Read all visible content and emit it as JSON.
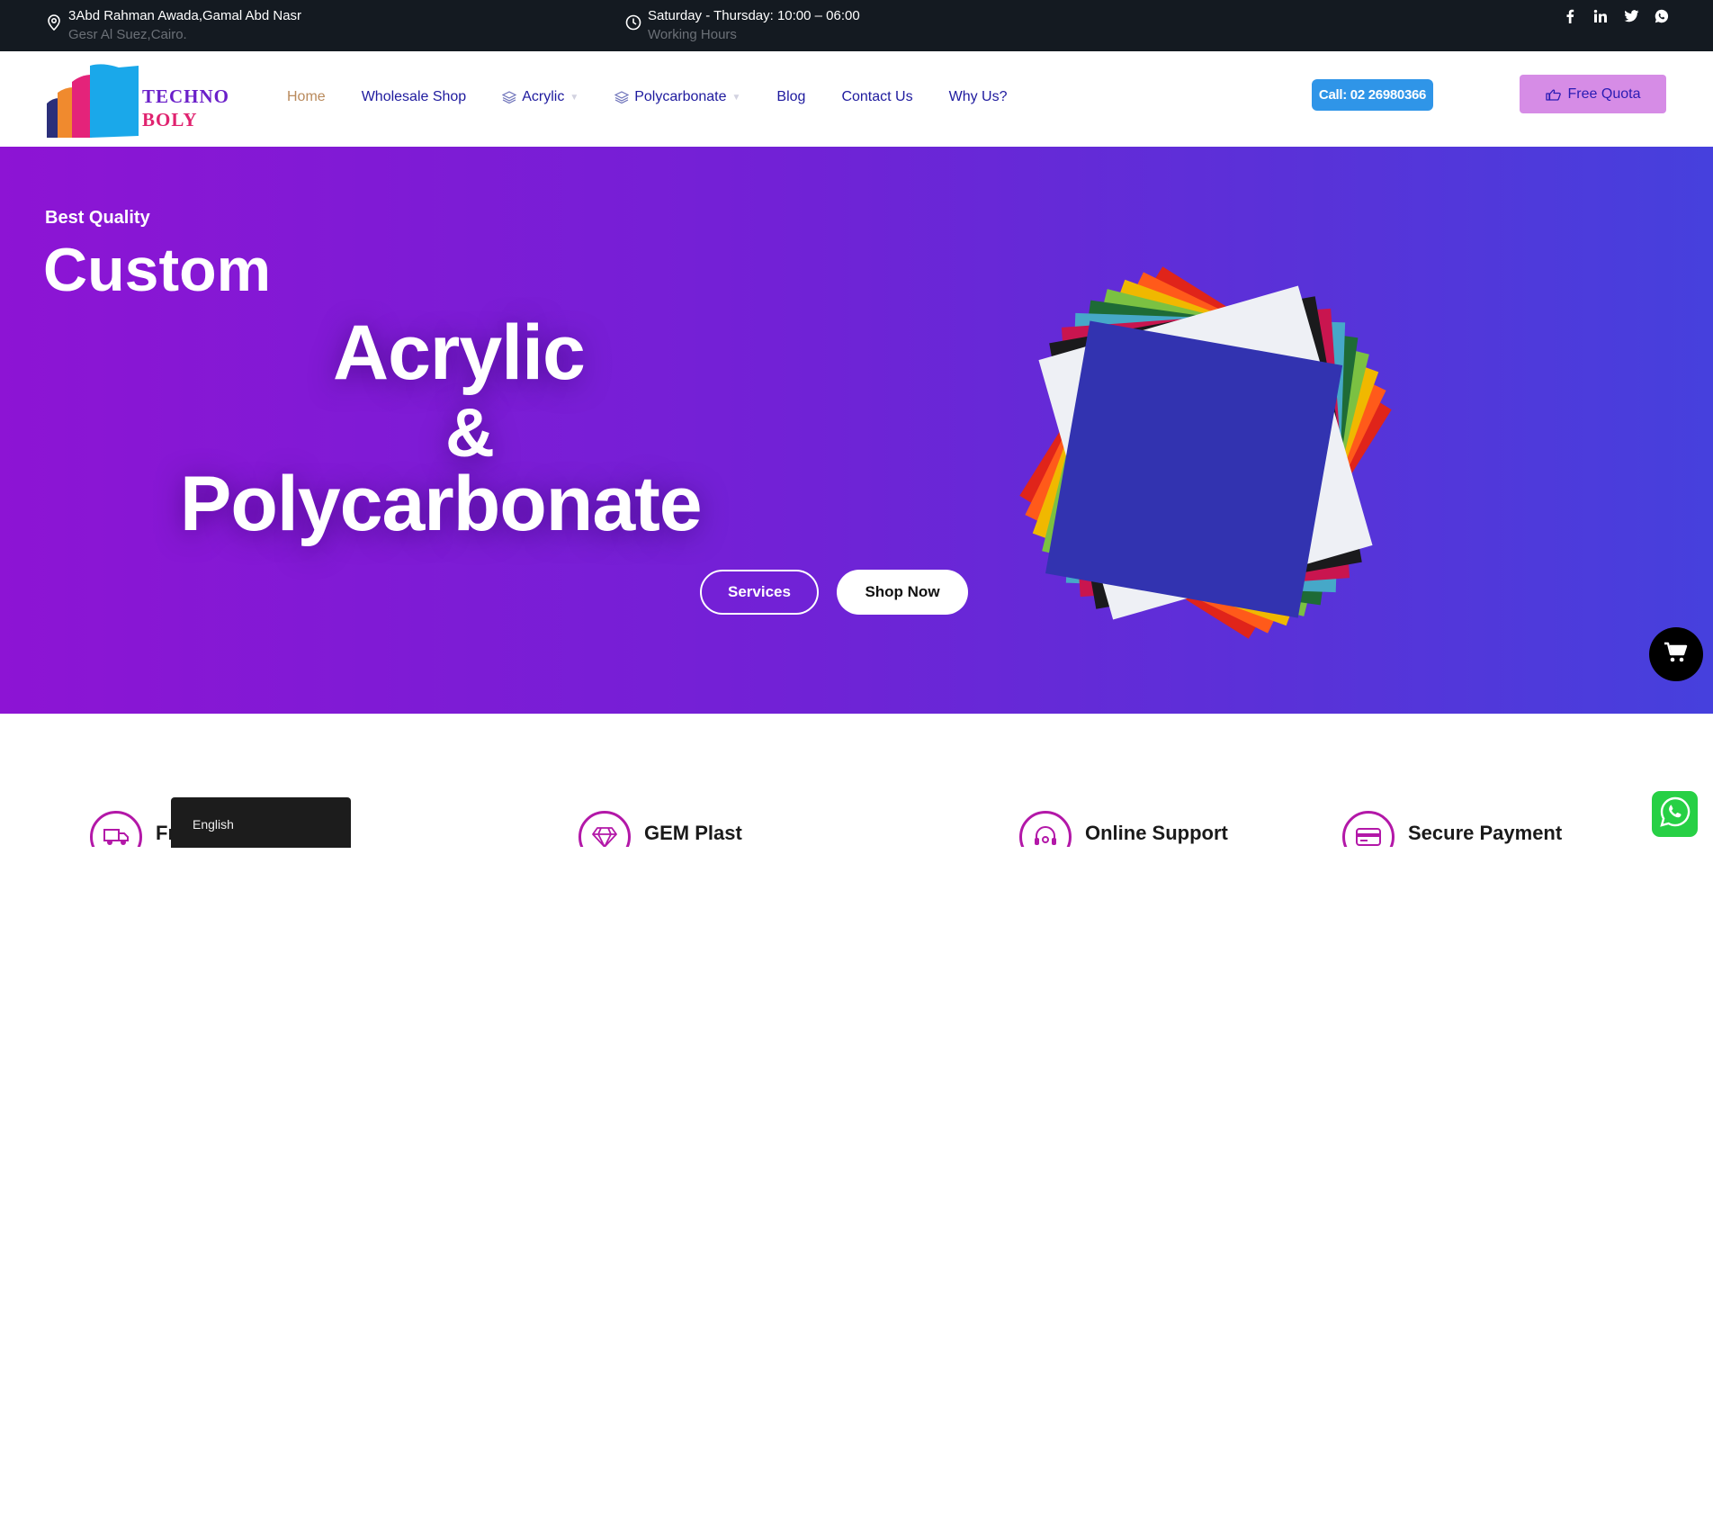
{
  "topbar": {
    "address_main": "3Abd Rahman Awada,Gamal Abd Nasr",
    "address_sub": "Gesr Al Suez,Cairo.",
    "hours_main": "Saturday - Thursday: 10:00 – 06:00",
    "hours_sub": "Working Hours",
    "social": [
      "facebook-icon",
      "linkedin-icon",
      "twitter-icon",
      "whatsapp-icon"
    ]
  },
  "logo": {
    "line1": "TECHNO",
    "line2": "BOLY"
  },
  "nav": {
    "items": [
      {
        "label": "Home"
      },
      {
        "label": "Wholesale Shop"
      },
      {
        "label": "Acrylic"
      },
      {
        "label": "Polycarbonate"
      },
      {
        "label": "Blog"
      },
      {
        "label": "Contact Us"
      },
      {
        "label": "Why Us?"
      }
    ],
    "call_label": "Call: 02 26980366",
    "quota_label": "Free Quota"
  },
  "hero": {
    "eyebrow": "Best Quality",
    "title1": "Custom",
    "title2": "Acrylic",
    "title3": "&",
    "title4": "Polycarbonate",
    "services_label": "Services",
    "shop_label": "Shop Now"
  },
  "features": [
    {
      "title": "Fr",
      "icon": "truck-icon"
    },
    {
      "title": "GEM Plast",
      "icon": "diamond-icon"
    },
    {
      "title": "Online Support",
      "icon": "headset-icon"
    },
    {
      "title": "Secure Payment",
      "icon": "card-icon"
    }
  ],
  "language": {
    "current": "English"
  },
  "colors": {
    "topbar_bg": "#141a21",
    "nav_text": "#1e1a9e",
    "nav_active": "#b98a5c",
    "call_bg": "#2f95e8",
    "quota_bg": "#d68ce6",
    "hero_start": "#8d14d4",
    "hero_end": "#4640dd",
    "feature_icon": "#b318a8",
    "whatsapp": "#27d045"
  }
}
